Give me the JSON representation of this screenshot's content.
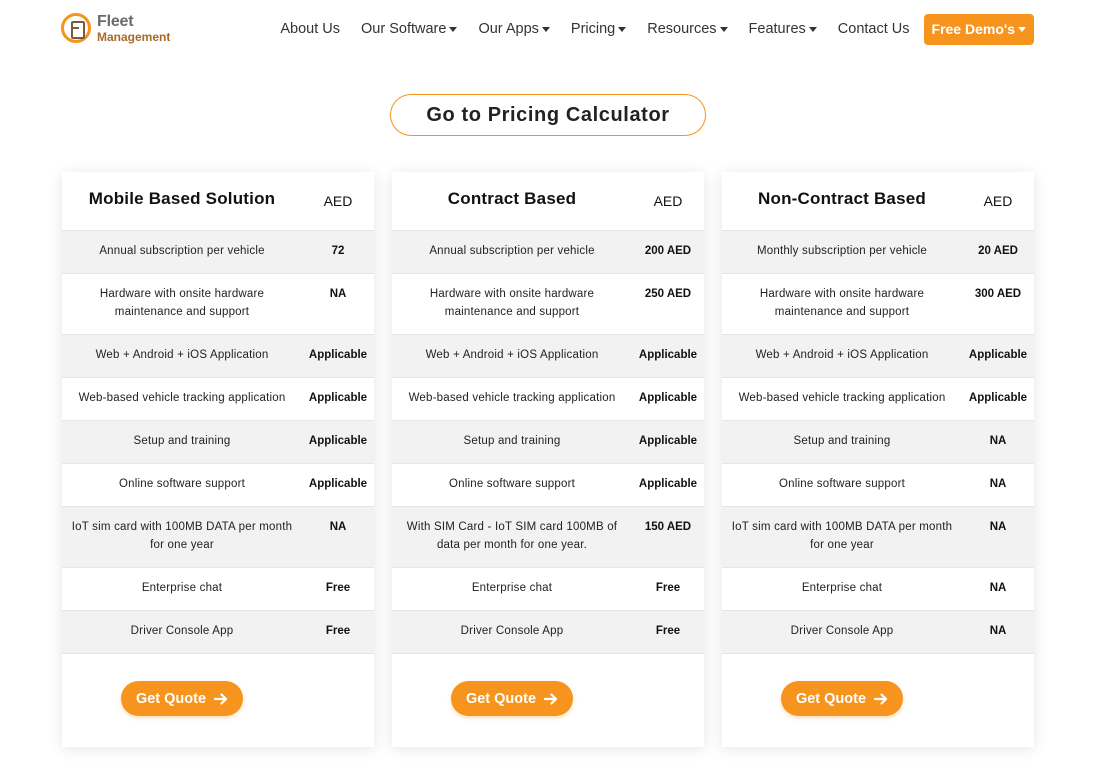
{
  "brand": {
    "line1": "Fleet",
    "line2": "Management"
  },
  "nav": {
    "items": [
      {
        "label": "About Us",
        "dropdown": false
      },
      {
        "label": "Our Software",
        "dropdown": true
      },
      {
        "label": "Our Apps",
        "dropdown": true
      },
      {
        "label": "Pricing",
        "dropdown": true
      },
      {
        "label": "Resources",
        "dropdown": true
      },
      {
        "label": "Features",
        "dropdown": true
      },
      {
        "label": "Contact Us",
        "dropdown": false
      }
    ],
    "demo_label": "Free Demo's"
  },
  "calculator_label": "Go to Pricing Calculator",
  "colors": {
    "accent": "#f7941d",
    "row_alt": "#f2f2f2"
  },
  "plans": [
    {
      "title": "Mobile Based Solution",
      "currency": "AED",
      "rows": [
        {
          "label": "Annual subscription per vehicle",
          "value": "72"
        },
        {
          "label": "Hardware with onsite hardware maintenance and support",
          "value": "NA"
        },
        {
          "label": "Web + Android + iOS Application",
          "value": "Applicable"
        },
        {
          "label": "Web-based vehicle tracking application",
          "value": "Applicable"
        },
        {
          "label": "Setup and training",
          "value": "Applicable"
        },
        {
          "label": "Online software support",
          "value": "Applicable"
        },
        {
          "label": "IoT sim card with 100MB DATA per month for one year",
          "value": "NA"
        },
        {
          "label": "Enterprise chat",
          "value": "Free"
        },
        {
          "label": "Driver Console App",
          "value": "Free"
        }
      ],
      "button": "Get Quote"
    },
    {
      "title": "Contract Based",
      "currency": "AED",
      "rows": [
        {
          "label": "Annual subscription per vehicle",
          "value": "200 AED"
        },
        {
          "label": "Hardware with onsite hardware maintenance and support",
          "value": "250 AED"
        },
        {
          "label": "Web + Android + iOS Application",
          "value": "Applicable"
        },
        {
          "label": "Web-based vehicle tracking application",
          "value": "Applicable"
        },
        {
          "label": "Setup and training",
          "value": "Applicable"
        },
        {
          "label": "Online software support",
          "value": "Applicable"
        },
        {
          "label": "With SIM Card - IoT SIM card 100MB of data per month for one year.",
          "value": "150 AED"
        },
        {
          "label": "Enterprise chat",
          "value": "Free"
        },
        {
          "label": "Driver Console App",
          "value": "Free"
        }
      ],
      "button": "Get Quote"
    },
    {
      "title": "Non-Contract Based",
      "currency": "AED",
      "rows": [
        {
          "label": "Monthly subscription per vehicle",
          "value": "20 AED"
        },
        {
          "label": "Hardware with onsite hardware maintenance and support",
          "value": "300 AED"
        },
        {
          "label": "Web + Android + iOS Application",
          "value": "Applicable"
        },
        {
          "label": "Web-based vehicle tracking application",
          "value": "Applicable"
        },
        {
          "label": "Setup and training",
          "value": "NA"
        },
        {
          "label": "Online software support",
          "value": "NA"
        },
        {
          "label": "IoT sim card with 100MB DATA per month for one year",
          "value": "NA"
        },
        {
          "label": "Enterprise chat",
          "value": "NA"
        },
        {
          "label": "Driver Console App",
          "value": "NA"
        }
      ],
      "button": "Get Quote"
    }
  ]
}
